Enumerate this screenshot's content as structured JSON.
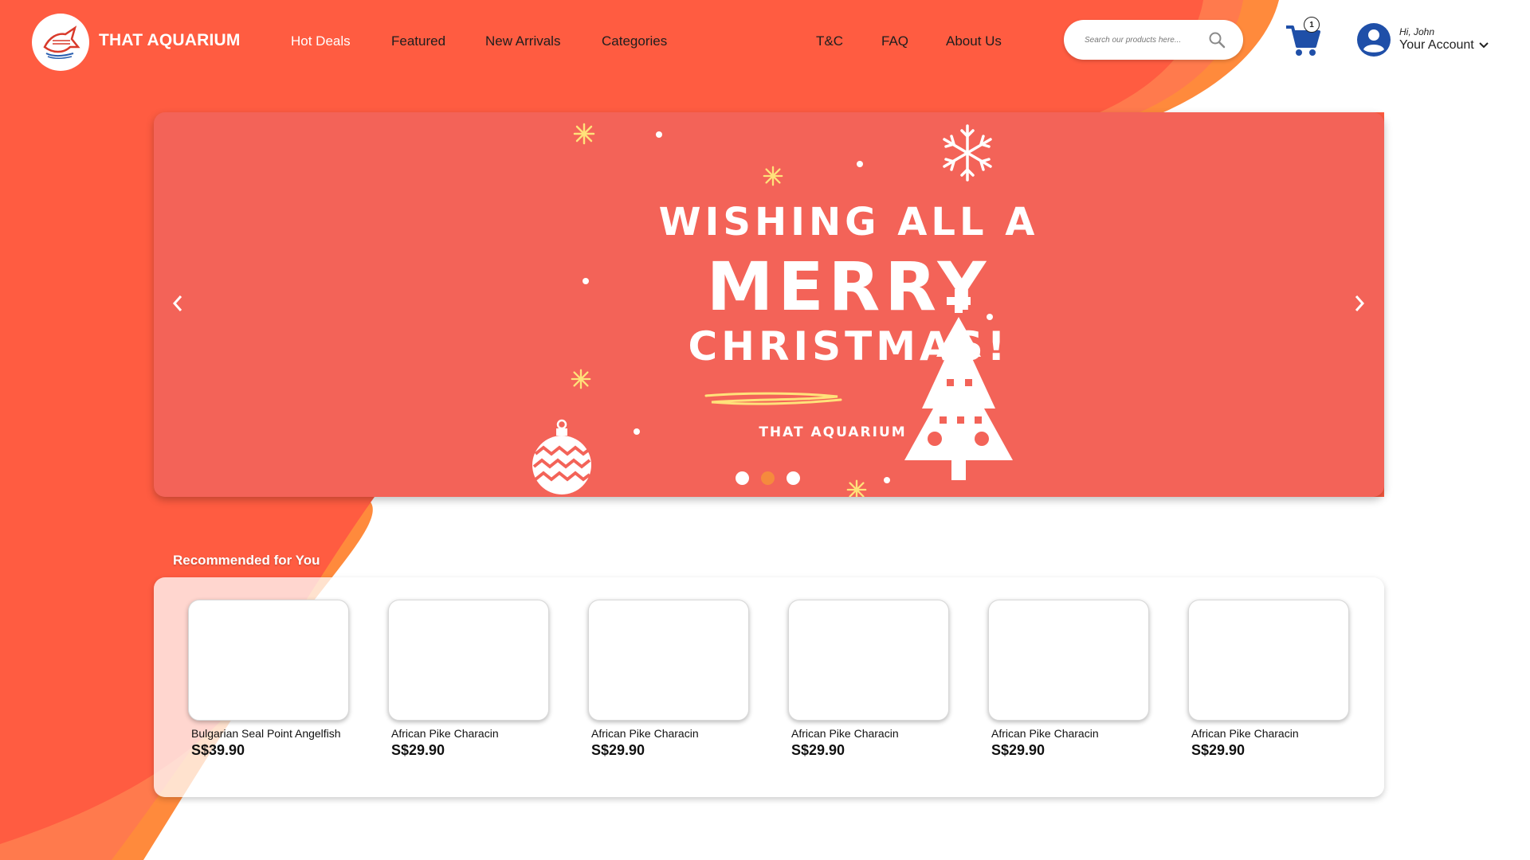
{
  "brand": {
    "name": "THAT AQUARIUM",
    "logo_icon": "angelfish-logo-icon"
  },
  "nav": {
    "items": [
      {
        "label": "Hot Deals",
        "active": true
      },
      {
        "label": "Featured"
      },
      {
        "label": "New Arrivals"
      },
      {
        "label": "Categories"
      },
      {
        "label": "T&C"
      },
      {
        "label": "FAQ"
      },
      {
        "label": "About Us"
      }
    ]
  },
  "search": {
    "placeholder": "Search our products here...",
    "icon": "search-icon"
  },
  "cart": {
    "icon": "cart-icon",
    "count": "1"
  },
  "account": {
    "greeting": "Hi, John",
    "label": "Your Account",
    "icon": "user-circle-icon"
  },
  "banner": {
    "line1": "WISHING ALL A",
    "line2": "MERRY",
    "line3": "CHRISTMAS!",
    "brand": "THAT AQUARIUM",
    "slides": 3,
    "active_slide": 2
  },
  "recommended": {
    "title": "Recommended for You",
    "products": [
      {
        "name": "Bulgarian Seal Point Angelfish",
        "price": "S$39.90"
      },
      {
        "name": "African Pike Characin",
        "price": "S$29.90"
      },
      {
        "name": "African Pike Characin",
        "price": "S$29.90"
      },
      {
        "name": "African Pike Characin",
        "price": "S$29.90"
      },
      {
        "name": "African Pike Characin",
        "price": "S$29.90"
      },
      {
        "name": "African Pike Characin",
        "price": "S$29.90"
      }
    ]
  },
  "colors": {
    "primary": "#ff5c41",
    "secondary": "#ff7a45",
    "accent_orange": "#ff8a3c",
    "banner": "#f36358",
    "icon_blue": "#1f4fa8"
  }
}
